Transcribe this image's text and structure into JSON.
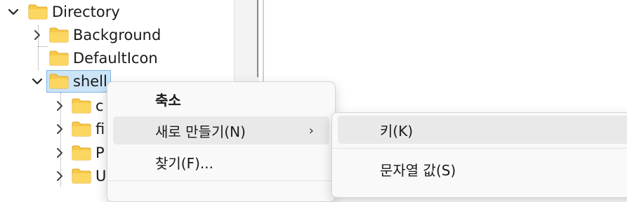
{
  "tree": {
    "root": {
      "label": "Directory"
    },
    "children": [
      {
        "label": "Background"
      },
      {
        "label": "DefaultIcon"
      },
      {
        "label": "shell"
      }
    ],
    "shell_children": [
      {
        "label": "c"
      },
      {
        "label": "fi"
      },
      {
        "label": "P"
      },
      {
        "label": "U"
      }
    ]
  },
  "context_menu": {
    "items": [
      {
        "label": "축소"
      },
      {
        "label": "새로 만들기(N)",
        "arrow": "›"
      },
      {
        "label": "찾기(F)..."
      }
    ]
  },
  "submenu": {
    "items": [
      {
        "label": "키(K)"
      },
      {
        "label": "문자열 값(S)"
      }
    ]
  },
  "colors": {
    "folder_yellow": "#f7c948",
    "selection": "#cce4f7",
    "hover": "#e9e9e9"
  }
}
